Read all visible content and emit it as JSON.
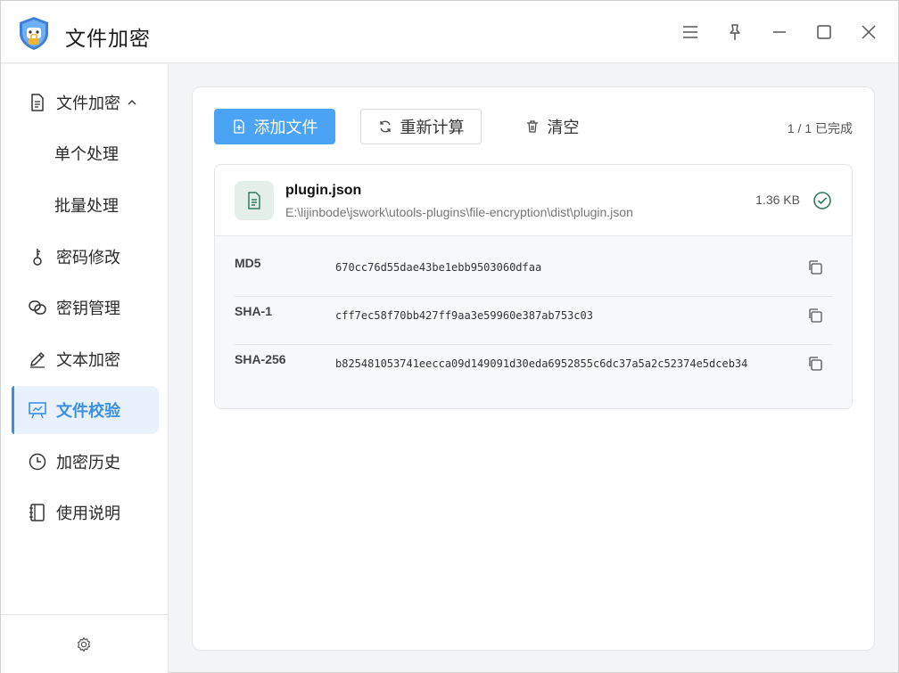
{
  "app": {
    "title": "文件加密"
  },
  "sidebar": {
    "items": [
      {
        "label": "文件加密",
        "icon": "document-icon"
      },
      {
        "label": "单个处理"
      },
      {
        "label": "批量处理"
      },
      {
        "label": "密码修改",
        "icon": "key-icon"
      },
      {
        "label": "密钥管理",
        "icon": "link-icon"
      },
      {
        "label": "文本加密",
        "icon": "pen-icon"
      },
      {
        "label": "文件校验",
        "icon": "presentation-icon",
        "active": true
      },
      {
        "label": "加密历史",
        "icon": "clock-icon"
      },
      {
        "label": "使用说明",
        "icon": "notebook-icon"
      }
    ]
  },
  "toolbar": {
    "add_label": "添加文件",
    "recalc_label": "重新计算",
    "clear_label": "清空",
    "status": "1 / 1 已完成"
  },
  "file": {
    "name": "plugin.json",
    "path": "E:\\lijinbode\\jswork\\utools-plugins\\file-encryption\\dist\\plugin.json",
    "size": "1.36 KB",
    "hashes": [
      {
        "label": "MD5",
        "value": "670cc76d55dae43be1ebb9503060dfaa"
      },
      {
        "label": "SHA-1",
        "value": "cff7ec58f70bb427ff9aa3e59960e387ab753c03"
      },
      {
        "label": "SHA-256",
        "value": "b825481053741eecca09d149091d30eda6952855c6dc37a5a2c52374e5dceb34"
      }
    ]
  },
  "colors": {
    "accent": "#4aa3f5",
    "active_text": "#3d8fe6",
    "active_bg": "#e8f1fc",
    "success": "#2e7d5b"
  }
}
